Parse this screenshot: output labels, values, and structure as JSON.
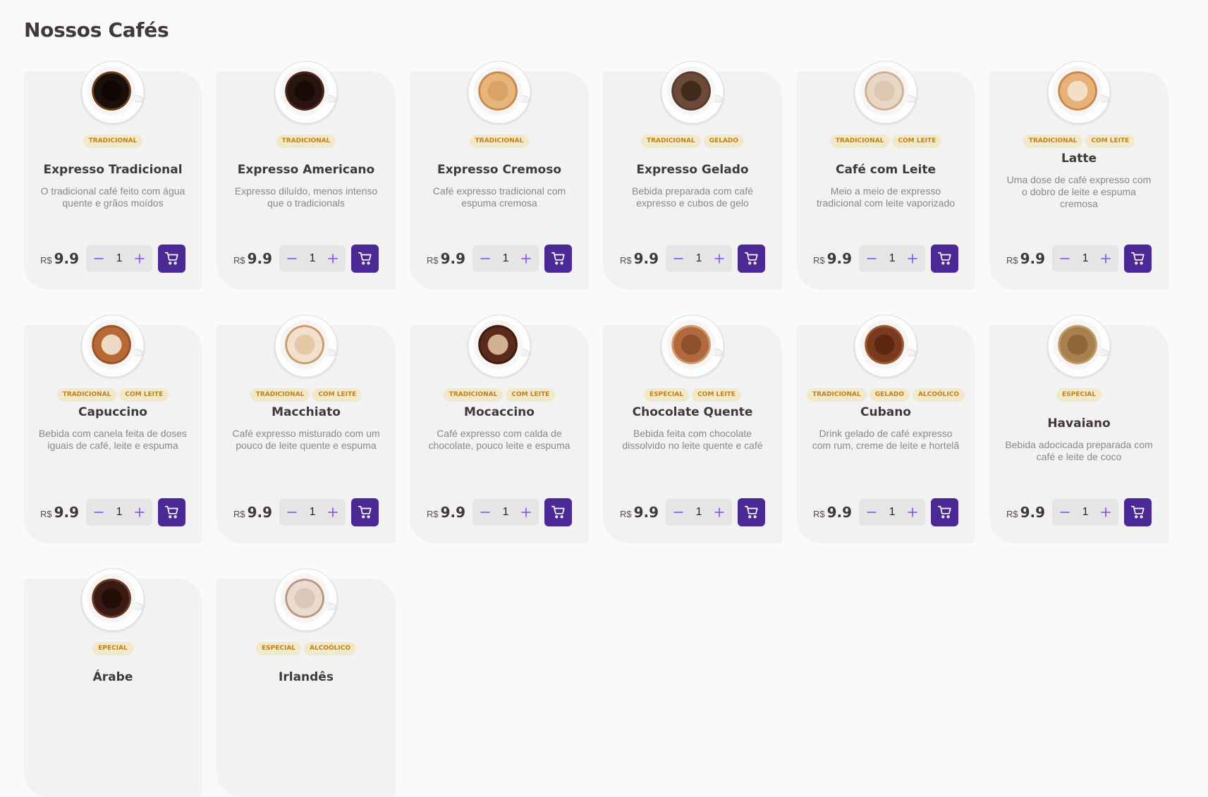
{
  "page": {
    "title": "Nossos Cafés"
  },
  "currency": "R$",
  "colors": {
    "accent": "#4B2995",
    "accent_light": "#8047F8",
    "tag_bg": "#F1E9C9",
    "tag_text": "#C47F17",
    "card_bg": "#F3F2F2"
  },
  "icons": {
    "minus": "minus-icon",
    "plus": "plus-icon",
    "cart": "shopping-cart-icon"
  },
  "coffees": [
    {
      "name": "Expresso Tradicional",
      "tags": [
        "Tradicional"
      ],
      "description": "O tradicional café feito com água quente e grãos moídos",
      "price": "9.9",
      "quantity": "1",
      "cup": {
        "foam": "#1a0f0a",
        "center": "#0d0604",
        "ring": "#6b3b1c"
      }
    },
    {
      "name": "Expresso Americano",
      "tags": [
        "Tradicional"
      ],
      "description": "Expresso diluído, menos intenso que o tradicionals",
      "price": "9.9",
      "quantity": "1",
      "cup": {
        "foam": "#2a1410",
        "center": "#150807",
        "ring": "#4a2418"
      }
    },
    {
      "name": "Expresso Cremoso",
      "tags": [
        "Tradicional"
      ],
      "description": "Café expresso tradicional com espuma cremosa",
      "price": "9.9",
      "quantity": "1",
      "cup": {
        "foam": "#e5b57c",
        "center": "#d8a063",
        "ring": "#c7894e"
      }
    },
    {
      "name": "Expresso Gelado",
      "tags": [
        "Tradicional",
        "Gelado"
      ],
      "description": "Bebida preparada com café expresso e cubos de gelo",
      "price": "9.9",
      "quantity": "1",
      "cup": {
        "foam": "#6b4a3a",
        "center": "#3a2418",
        "ring": "#5a3a2a"
      }
    },
    {
      "name": "Café com Leite",
      "tags": [
        "Tradicional",
        "Com leite"
      ],
      "description": "Meio a meio de expresso tradicional com leite vaporizado",
      "price": "9.9",
      "quantity": "1",
      "cup": {
        "foam": "#e8d6c6",
        "center": "#dcc3ac",
        "ring": "#cfae92"
      }
    },
    {
      "name": "Latte",
      "tags": [
        "Tradicional",
        "Com leite"
      ],
      "description": "Uma dose de café expresso com o dobro de leite e espuma cremosa",
      "price": "9.9",
      "quantity": "1",
      "cup": {
        "foam": "#e7b27a",
        "center": "#f5e6d3",
        "ring": "#c9884b"
      }
    },
    {
      "name": "Capuccino",
      "tags": [
        "Tradicional",
        "Com leite"
      ],
      "description": "Bebida com canela feita de doses iguais de café, leite e espuma",
      "price": "9.9",
      "quantity": "1",
      "cup": {
        "foam": "#b86a36",
        "center": "#f7ece0",
        "ring": "#9a5226"
      }
    },
    {
      "name": "Macchiato",
      "tags": [
        "Tradicional",
        "Com leite"
      ],
      "description": "Café expresso misturado com um pouco de leite quente e espuma",
      "price": "9.9",
      "quantity": "1",
      "cup": {
        "foam": "#f1e0cc",
        "center": "#e2c4a2",
        "ring": "#c99a6c"
      }
    },
    {
      "name": "Mocaccino",
      "tags": [
        "Tradicional",
        "Com leite"
      ],
      "description": "Café expresso com calda de chocolate, pouco leite e espuma",
      "price": "9.9",
      "quantity": "1",
      "cup": {
        "foam": "#5a2a1a",
        "center": "#e8c9a8",
        "ring": "#3f1a10"
      }
    },
    {
      "name": "Chocolate Quente",
      "tags": [
        "Especial",
        "Com leite"
      ],
      "description": "Bebida feita com chocolate dissolvido no leite quente e café",
      "price": "9.9",
      "quantity": "1",
      "cup": {
        "foam": "#b06a3e",
        "center": "#8a4a2a",
        "ring": "#d39a6c"
      }
    },
    {
      "name": "Cubano",
      "tags": [
        "Tradicional",
        "Gelado",
        "Alcoólico"
      ],
      "description": "Drink gelado de café expresso com rum, creme de leite e hortelã",
      "price": "9.9",
      "quantity": "1",
      "cup": {
        "foam": "#7a3a1e",
        "center": "#5a2410",
        "ring": "#9a5a34"
      }
    },
    {
      "name": "Havaiano",
      "tags": [
        "Especial"
      ],
      "description": "Bebida adocicada preparada com café e leite de coco",
      "price": "9.9",
      "quantity": "1",
      "cup": {
        "foam": "#a88050",
        "center": "#8a6234",
        "ring": "#c29a68"
      }
    },
    {
      "name": "Árabe",
      "tags": [
        "Epecial"
      ],
      "description": "",
      "price": "",
      "quantity": "",
      "cup": {
        "foam": "#3a1a12",
        "center": "#1e0c08",
        "ring": "#6a3a26"
      }
    },
    {
      "name": "Irlandês",
      "tags": [
        "Especial",
        "Alcoólico"
      ],
      "description": "",
      "price": "",
      "quantity": "",
      "cup": {
        "foam": "#eadbd0",
        "center": "#d9c2b0",
        "ring": "#b89680"
      }
    }
  ]
}
